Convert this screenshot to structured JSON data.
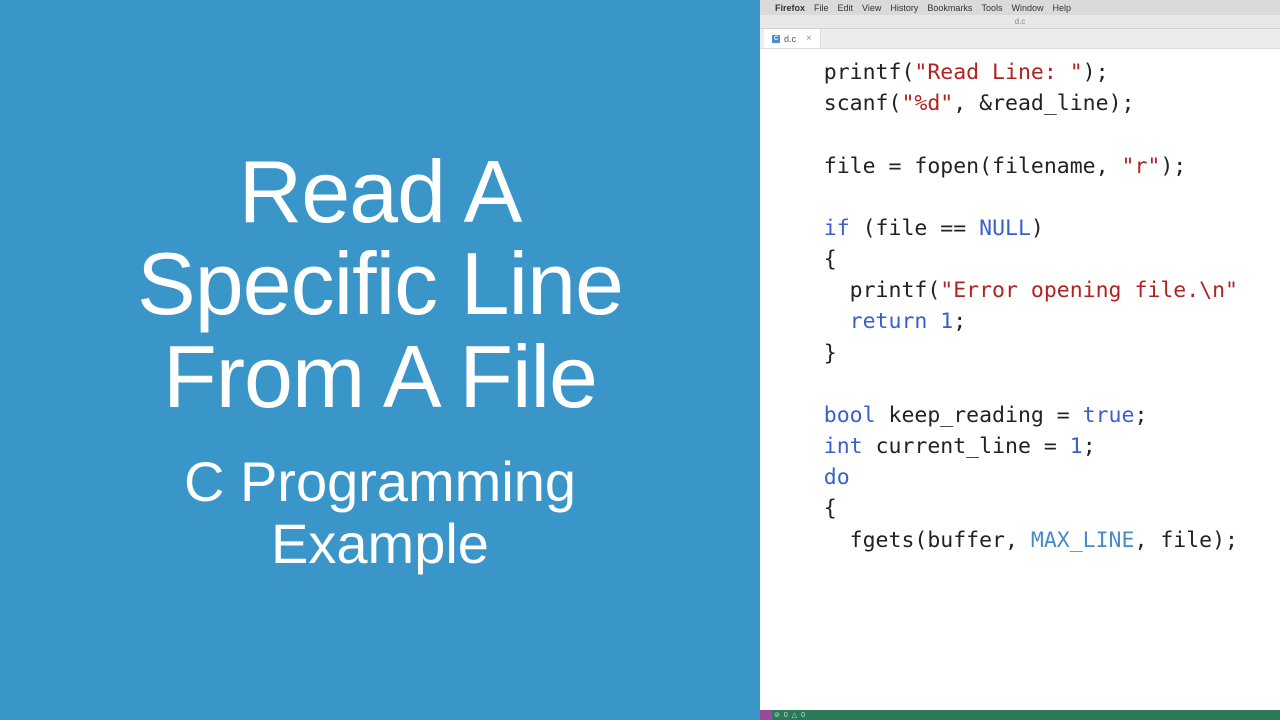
{
  "left": {
    "title_line1": "Read A",
    "title_line2": "Specific Line",
    "title_line3": "From A File",
    "subtitle_line1": "C Programming",
    "subtitle_line2": "Example"
  },
  "menubar": {
    "app": "Firefox",
    "items": [
      "File",
      "Edit",
      "View",
      "History",
      "Bookmarks",
      "Tools",
      "Window",
      "Help"
    ]
  },
  "window": {
    "title": "d.c"
  },
  "tab": {
    "filename": "d.c",
    "icon_letter": "C"
  },
  "code": {
    "l1a": "    printf(",
    "l1b": "\"Read Line: \"",
    "l1c": ");",
    "l2a": "    scanf(",
    "l2b": "\"%d\"",
    "l2c": ", &read_line);",
    "l3": "",
    "l4a": "    file = fopen(filename, ",
    "l4b": "\"r\"",
    "l4c": ");",
    "l5": "",
    "l6a": "    ",
    "l6b": "if",
    "l6c": " (file == ",
    "l6d": "NULL",
    "l6e": ")",
    "l7": "    {",
    "l8a": "      printf(",
    "l8b": "\"Error opening file.\\n\"",
    "l9a": "      ",
    "l9b": "return",
    "l9c": " ",
    "l9d": "1",
    "l9e": ";",
    "l10": "    }",
    "l11": "",
    "l12a": "    ",
    "l12b": "bool",
    "l12c": " keep_reading = ",
    "l12d": "true",
    "l12e": ";",
    "l13a": "    ",
    "l13b": "int",
    "l13c": " current_line = ",
    "l13d": "1",
    "l13e": ";",
    "l14a": "    ",
    "l14b": "do",
    "l15": "    {",
    "l16a": "      fgets(buffer, ",
    "l16b": "MAX_LINE",
    "l16c": ", file);"
  },
  "statusbar": {
    "errors": "0",
    "warnings": "0"
  }
}
